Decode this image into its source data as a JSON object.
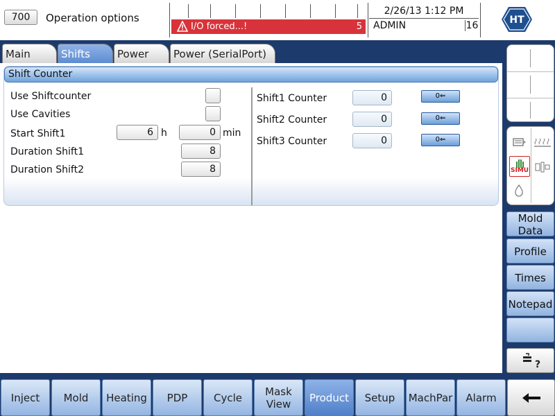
{
  "header": {
    "screen_number": "700",
    "title": "Operation options",
    "alarm": {
      "text": "I/O forced...!",
      "count": "5",
      "color": "#d8333a"
    },
    "datetime": "2/26/13 1:12 PM",
    "user": "ADMIN",
    "user_level": "16",
    "logo_text": "HT"
  },
  "tabs": [
    {
      "label": "Main",
      "active": false
    },
    {
      "label": "Shifts",
      "active": true
    },
    {
      "label": "Power",
      "active": false
    },
    {
      "label": "Power (SerialPort)",
      "active": false
    }
  ],
  "panel": {
    "title": "Shift Counter",
    "left": {
      "use_shiftcounter": {
        "label": "Use Shiftcounter",
        "checked": false
      },
      "use_cavities": {
        "label": "Use Cavities",
        "checked": false
      },
      "start_shift1": {
        "label": "Start Shift1",
        "hours": "6",
        "hours_unit": "h",
        "minutes": "0",
        "minutes_unit": "min"
      },
      "duration_shift1": {
        "label": "Duration Shift1",
        "value": "8"
      },
      "duration_shift2": {
        "label": "Duration Shift2",
        "value": "8"
      }
    },
    "counters": [
      {
        "label": "Shift1 Counter",
        "value": "0",
        "reset_label": "0⇐"
      },
      {
        "label": "Shift2 Counter",
        "value": "0",
        "reset_label": "0⇐"
      },
      {
        "label": "Shift3 Counter",
        "value": "0",
        "reset_label": "0⇐"
      }
    ]
  },
  "sidebar": {
    "simu_label": "SIMU",
    "buttons": [
      {
        "label": "Mold Data"
      },
      {
        "label": "Profile"
      },
      {
        "label": "Times"
      },
      {
        "label": "Notepad"
      },
      {
        "label": ""
      }
    ]
  },
  "nav": [
    {
      "label": "Inject",
      "active": false
    },
    {
      "label": "Mold",
      "active": false
    },
    {
      "label": "Heating",
      "active": false
    },
    {
      "label": "PDP",
      "active": false
    },
    {
      "label": "Cycle",
      "active": false
    },
    {
      "label": "Mask View",
      "active": false
    },
    {
      "label": "Product",
      "active": true
    },
    {
      "label": "Setup",
      "active": false
    },
    {
      "label": "MachPar",
      "active": false
    },
    {
      "label": "Alarm",
      "active": false
    }
  ],
  "nav_back_icon": "arrow-left-icon"
}
